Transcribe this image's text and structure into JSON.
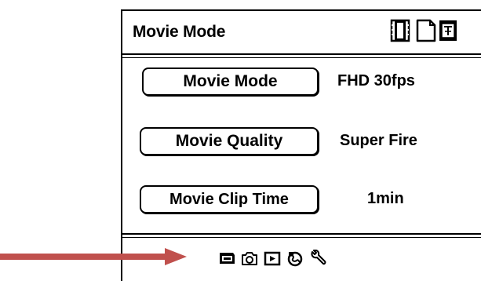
{
  "header": {
    "title": "Movie Mode",
    "icons": [
      "film-strip-icon",
      "page-icon",
      "page-gear-icon"
    ]
  },
  "menu": [
    {
      "label": "Movie Mode",
      "value": "FHD 30fps"
    },
    {
      "label": "Movie Quality",
      "value": "Super Fire"
    },
    {
      "label": "Movie Clip Time",
      "value": "1min"
    }
  ],
  "bottom_bar": {
    "icons": [
      "video-camera-icon",
      "camera-icon",
      "playback-icon",
      "world-icon",
      "wrench-icon"
    ]
  },
  "annotation": {
    "arrow_color": "#c0504d",
    "icon": "arrow-right-icon"
  }
}
